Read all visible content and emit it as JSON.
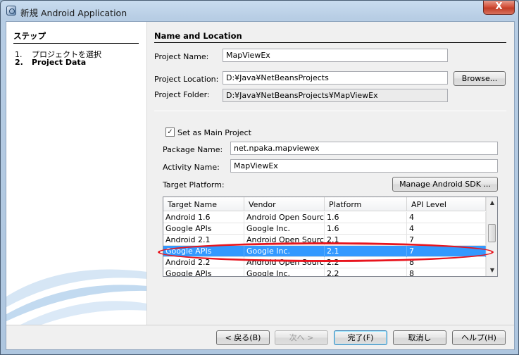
{
  "window": {
    "title": "新規 Android Application",
    "close_label": "X"
  },
  "steps": {
    "header": "ステップ",
    "items": [
      {
        "num": "1.",
        "label": "プロジェクトを選択"
      },
      {
        "num": "2.",
        "label": "Project Data"
      }
    ]
  },
  "form": {
    "section_title": "Name and Location",
    "project_name_label": "Project Name:",
    "project_name_value": "MapViewEx",
    "project_location_label": "Project Location:",
    "project_location_value": "D:¥Java¥NetBeansProjects",
    "browse_label": "Browse...",
    "project_folder_label": "Project Folder:",
    "project_folder_value": "D:¥Java¥NetBeansProjects¥MapViewEx",
    "main_project_checked": true,
    "main_project_label": "Set as Main Project",
    "package_name_label": "Package Name:",
    "package_name_value": "net.npaka.mapviewex",
    "activity_name_label": "Activity Name:",
    "activity_name_value": "MapViewEx",
    "target_platform_label": "Target Platform:",
    "manage_sdk_label": "Manage Android SDK ..."
  },
  "table": {
    "columns": [
      "Target Name",
      "Vendor",
      "Platform",
      "API Level"
    ],
    "rows": [
      [
        "Android 1.6",
        "Android Open Sourc...",
        "1.6",
        "4"
      ],
      [
        "Google APIs",
        "Google Inc.",
        "1.6",
        "4"
      ],
      [
        "Android 2.1",
        "Android Open Sourc...",
        "2.1",
        "7"
      ],
      [
        "Google APIs",
        "Google Inc.",
        "2.1",
        "7"
      ],
      [
        "Android 2.2",
        "Android Open Sourc...",
        "2.2",
        "8"
      ],
      [
        "Google APIs",
        "Google Inc.",
        "2.2",
        "8"
      ]
    ],
    "selected_row_index": 3
  },
  "footer": {
    "back_label": "< 戻る(B)",
    "next_label": "次へ >",
    "finish_label": "完了(F)",
    "cancel_label": "取消し",
    "help_label": "ヘルプ(H)"
  },
  "colors": {
    "selection": "#3399ff",
    "highlight": "#e8141d"
  }
}
